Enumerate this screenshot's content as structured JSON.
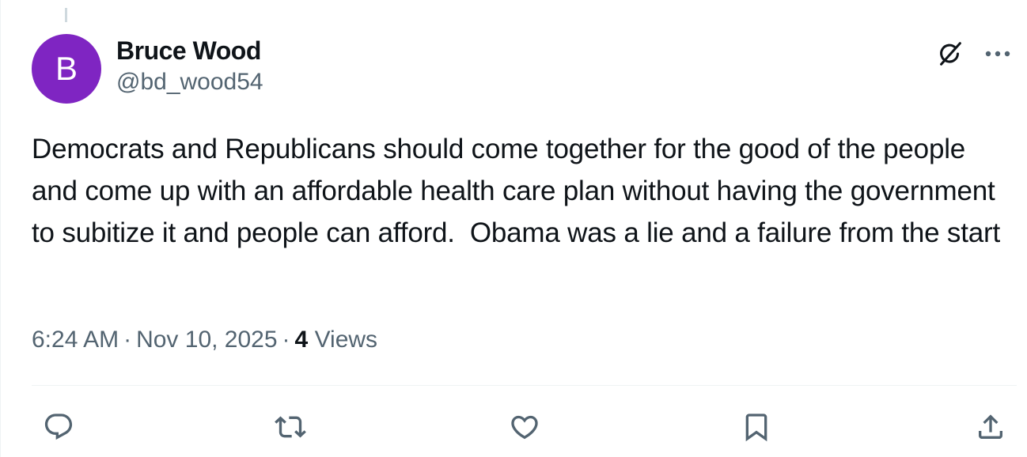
{
  "tweet": {
    "avatar_letter": "B",
    "avatar_color": "#7f25c2",
    "display_name": "Bruce Wood",
    "handle": "@bd_wood54",
    "text": "Democrats and Republicans should come together for the good of the people and come up with an affordable health care plan without having the government to subitize it and people can afford.  Obama was a lie and a failure from the start",
    "time": "6:24 AM",
    "date": "Nov 10, 2025",
    "separator": "·",
    "views_count": "4",
    "views_label": "Views"
  },
  "icons": {
    "header": [
      "grok-icon",
      "more-icon"
    ],
    "actions": [
      "reply-icon",
      "retweet-icon",
      "like-icon",
      "bookmark-icon",
      "share-icon"
    ]
  },
  "colors": {
    "text_primary": "#0f1419",
    "text_secondary": "#536471",
    "border": "#eff3f4"
  }
}
